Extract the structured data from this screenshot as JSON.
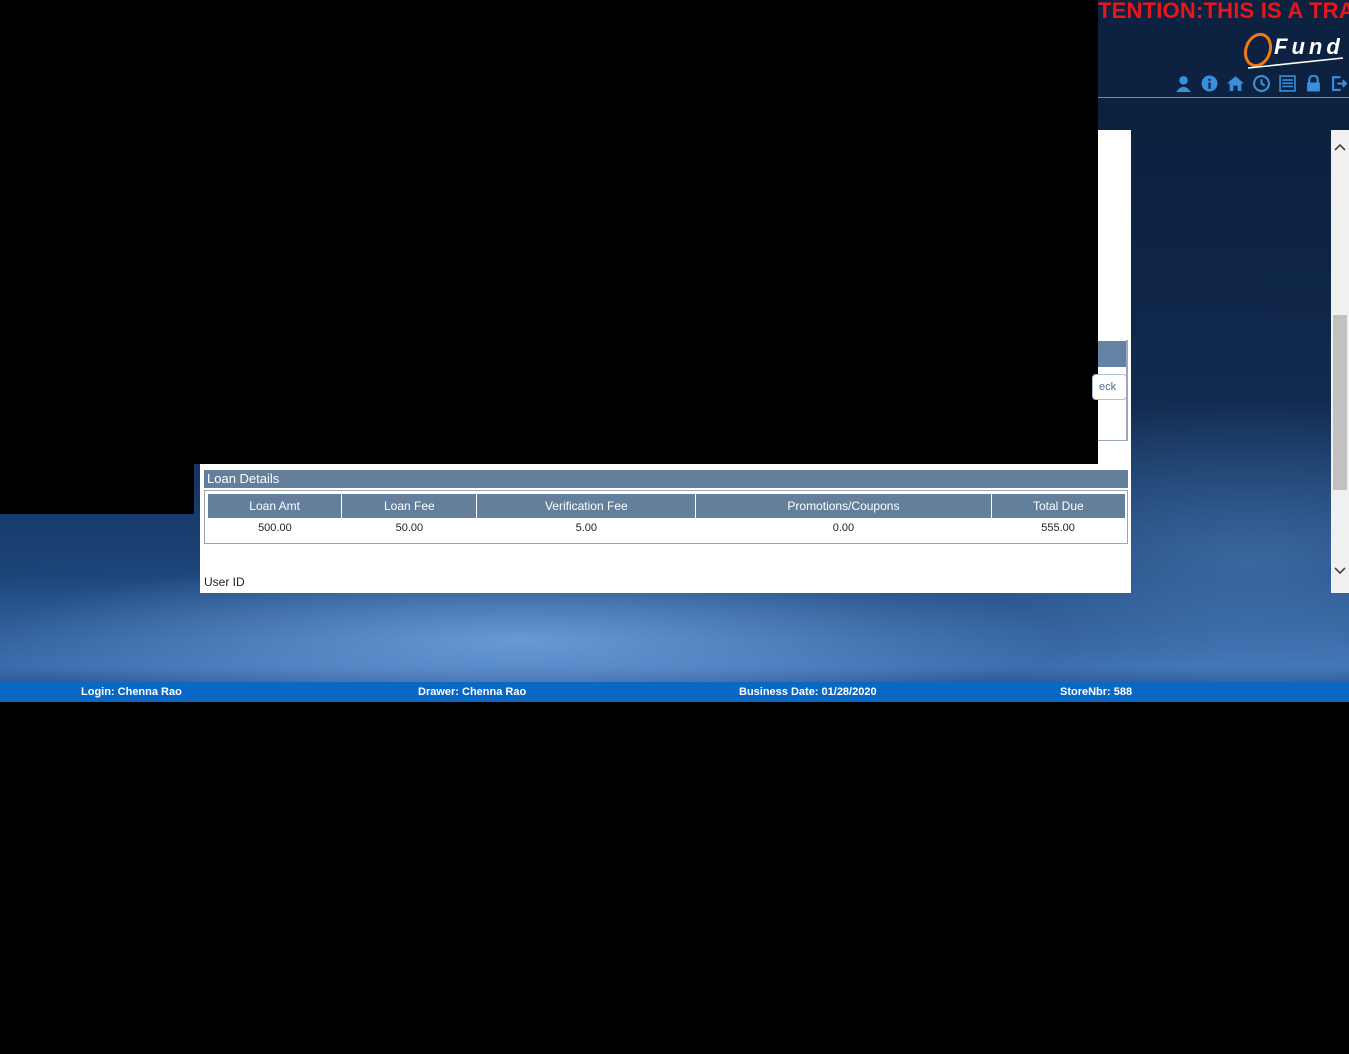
{
  "header": {
    "banner": "TENTION:THIS IS A TRAI",
    "logo_text": "Fund",
    "icons": [
      "user-icon",
      "info-icon",
      "home-icon",
      "clock-icon",
      "list-icon",
      "lock-icon",
      "logout-icon"
    ]
  },
  "partial": {
    "button_label": "eck"
  },
  "loan_details": {
    "title": "Loan Details",
    "columns": [
      "Loan Amt",
      "Loan Fee",
      "Verification Fee",
      "Promotions/Coupons",
      "Total Due"
    ],
    "values": [
      "500.00",
      "50.00",
      "5.00",
      "0.00",
      "555.00"
    ]
  },
  "form": {
    "user_id_label": "User ID"
  },
  "status": {
    "login": "Login: Chenna Rao",
    "drawer": "Drawer: Chenna Rao",
    "business_date": "Business Date: 01/28/2020",
    "store": "StoreNbr: 588"
  },
  "colors": {
    "banner": "#e8161b",
    "header_bar": "#637f9c",
    "status_bar": "#0868c3",
    "logo_accent": "#f07a16"
  }
}
